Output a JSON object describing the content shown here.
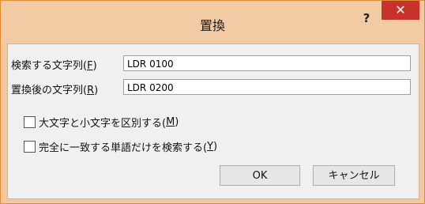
{
  "dialog": {
    "title": "置換",
    "help_label": "?",
    "close_label": "✕"
  },
  "search": {
    "label_prefix": "検索する文字列(",
    "label_key": "F",
    "label_suffix": ")",
    "value": "LDR 0100"
  },
  "replace": {
    "label_prefix": "置換後の文字列(",
    "label_key": "R",
    "label_suffix": ")",
    "value": "LDR 0200"
  },
  "options": {
    "match_case": {
      "label_prefix": "大文字と小文字を区別する(",
      "label_key": "M",
      "label_suffix": ")",
      "checked": false
    },
    "whole_word": {
      "label_prefix": "完全に一致する単語だけを検索する(",
      "label_key": "Y",
      "label_suffix": ")",
      "checked": false
    }
  },
  "buttons": {
    "ok_label": "OK",
    "cancel_label": "キャンセル"
  }
}
